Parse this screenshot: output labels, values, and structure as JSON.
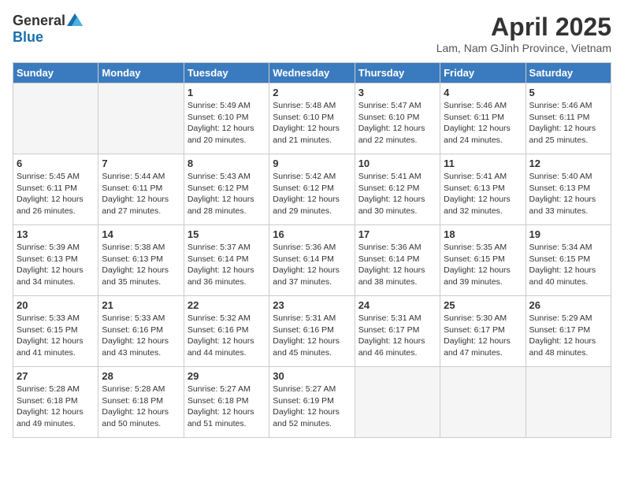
{
  "header": {
    "logo_general": "General",
    "logo_blue": "Blue",
    "title": "April 2025",
    "location": "Lam, Nam GJinh Province, Vietnam"
  },
  "days_of_week": [
    "Sunday",
    "Monday",
    "Tuesday",
    "Wednesday",
    "Thursday",
    "Friday",
    "Saturday"
  ],
  "weeks": [
    [
      {
        "day": null
      },
      {
        "day": null
      },
      {
        "day": "1",
        "sunrise": "5:49 AM",
        "sunset": "6:10 PM",
        "daylight": "12 hours and 20 minutes."
      },
      {
        "day": "2",
        "sunrise": "5:48 AM",
        "sunset": "6:10 PM",
        "daylight": "12 hours and 21 minutes."
      },
      {
        "day": "3",
        "sunrise": "5:47 AM",
        "sunset": "6:10 PM",
        "daylight": "12 hours and 22 minutes."
      },
      {
        "day": "4",
        "sunrise": "5:46 AM",
        "sunset": "6:11 PM",
        "daylight": "12 hours and 24 minutes."
      },
      {
        "day": "5",
        "sunrise": "5:46 AM",
        "sunset": "6:11 PM",
        "daylight": "12 hours and 25 minutes."
      }
    ],
    [
      {
        "day": "6",
        "sunrise": "5:45 AM",
        "sunset": "6:11 PM",
        "daylight": "12 hours and 26 minutes."
      },
      {
        "day": "7",
        "sunrise": "5:44 AM",
        "sunset": "6:11 PM",
        "daylight": "12 hours and 27 minutes."
      },
      {
        "day": "8",
        "sunrise": "5:43 AM",
        "sunset": "6:12 PM",
        "daylight": "12 hours and 28 minutes."
      },
      {
        "day": "9",
        "sunrise": "5:42 AM",
        "sunset": "6:12 PM",
        "daylight": "12 hours and 29 minutes."
      },
      {
        "day": "10",
        "sunrise": "5:41 AM",
        "sunset": "6:12 PM",
        "daylight": "12 hours and 30 minutes."
      },
      {
        "day": "11",
        "sunrise": "5:41 AM",
        "sunset": "6:13 PM",
        "daylight": "12 hours and 32 minutes."
      },
      {
        "day": "12",
        "sunrise": "5:40 AM",
        "sunset": "6:13 PM",
        "daylight": "12 hours and 33 minutes."
      }
    ],
    [
      {
        "day": "13",
        "sunrise": "5:39 AM",
        "sunset": "6:13 PM",
        "daylight": "12 hours and 34 minutes."
      },
      {
        "day": "14",
        "sunrise": "5:38 AM",
        "sunset": "6:13 PM",
        "daylight": "12 hours and 35 minutes."
      },
      {
        "day": "15",
        "sunrise": "5:37 AM",
        "sunset": "6:14 PM",
        "daylight": "12 hours and 36 minutes."
      },
      {
        "day": "16",
        "sunrise": "5:36 AM",
        "sunset": "6:14 PM",
        "daylight": "12 hours and 37 minutes."
      },
      {
        "day": "17",
        "sunrise": "5:36 AM",
        "sunset": "6:14 PM",
        "daylight": "12 hours and 38 minutes."
      },
      {
        "day": "18",
        "sunrise": "5:35 AM",
        "sunset": "6:15 PM",
        "daylight": "12 hours and 39 minutes."
      },
      {
        "day": "19",
        "sunrise": "5:34 AM",
        "sunset": "6:15 PM",
        "daylight": "12 hours and 40 minutes."
      }
    ],
    [
      {
        "day": "20",
        "sunrise": "5:33 AM",
        "sunset": "6:15 PM",
        "daylight": "12 hours and 41 minutes."
      },
      {
        "day": "21",
        "sunrise": "5:33 AM",
        "sunset": "6:16 PM",
        "daylight": "12 hours and 43 minutes."
      },
      {
        "day": "22",
        "sunrise": "5:32 AM",
        "sunset": "6:16 PM",
        "daylight": "12 hours and 44 minutes."
      },
      {
        "day": "23",
        "sunrise": "5:31 AM",
        "sunset": "6:16 PM",
        "daylight": "12 hours and 45 minutes."
      },
      {
        "day": "24",
        "sunrise": "5:31 AM",
        "sunset": "6:17 PM",
        "daylight": "12 hours and 46 minutes."
      },
      {
        "day": "25",
        "sunrise": "5:30 AM",
        "sunset": "6:17 PM",
        "daylight": "12 hours and 47 minutes."
      },
      {
        "day": "26",
        "sunrise": "5:29 AM",
        "sunset": "6:17 PM",
        "daylight": "12 hours and 48 minutes."
      }
    ],
    [
      {
        "day": "27",
        "sunrise": "5:28 AM",
        "sunset": "6:18 PM",
        "daylight": "12 hours and 49 minutes."
      },
      {
        "day": "28",
        "sunrise": "5:28 AM",
        "sunset": "6:18 PM",
        "daylight": "12 hours and 50 minutes."
      },
      {
        "day": "29",
        "sunrise": "5:27 AM",
        "sunset": "6:18 PM",
        "daylight": "12 hours and 51 minutes."
      },
      {
        "day": "30",
        "sunrise": "5:27 AM",
        "sunset": "6:19 PM",
        "daylight": "12 hours and 52 minutes."
      },
      {
        "day": null
      },
      {
        "day": null
      },
      {
        "day": null
      }
    ]
  ],
  "labels": {
    "sunrise": "Sunrise:",
    "sunset": "Sunset:",
    "daylight": "Daylight:"
  }
}
